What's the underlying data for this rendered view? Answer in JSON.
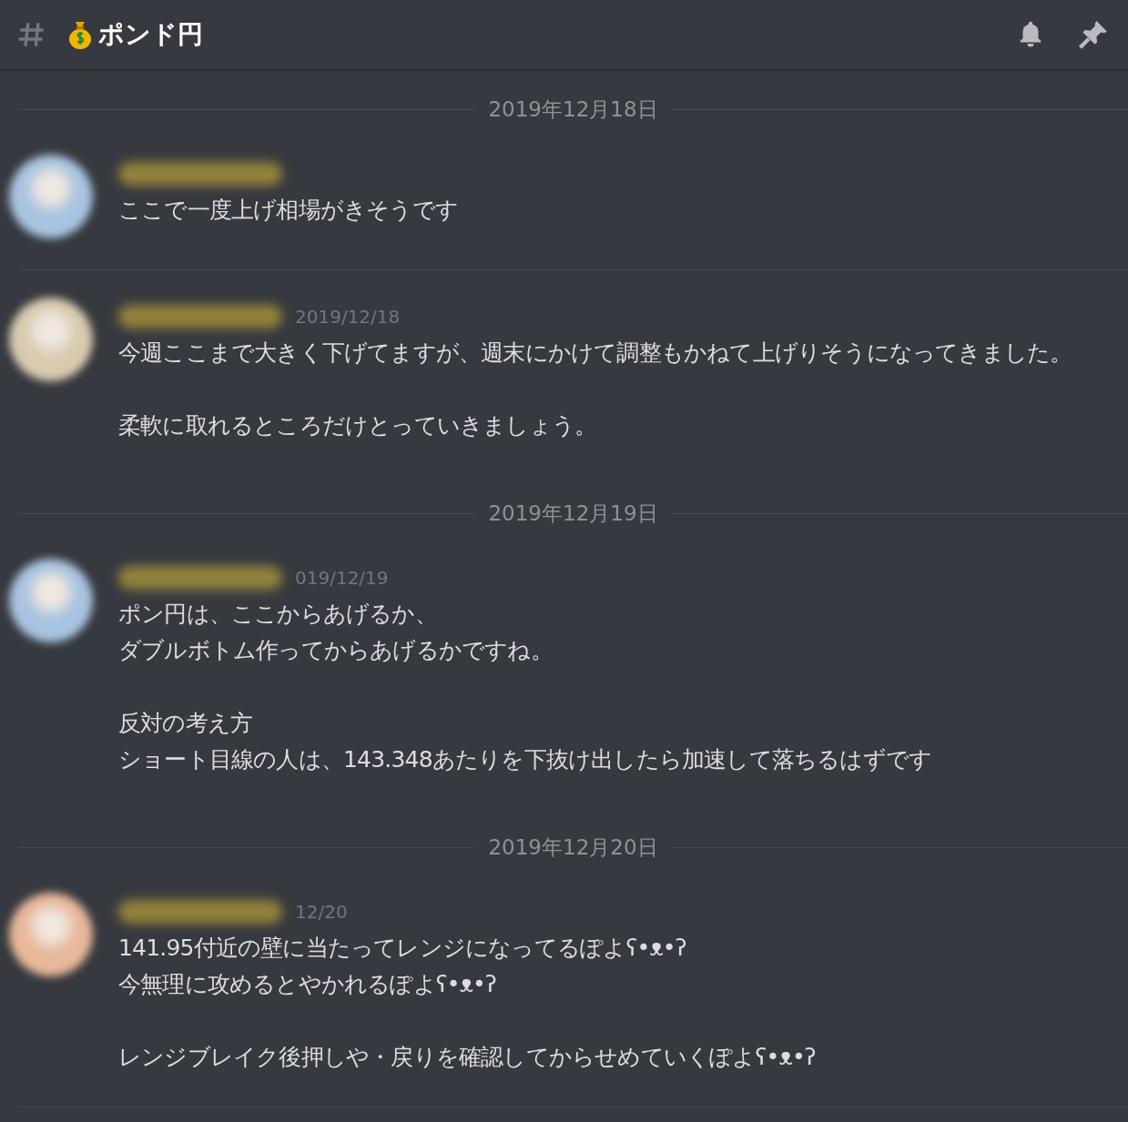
{
  "channel": {
    "title": "ポンド円"
  },
  "feed": [
    {
      "kind": "date",
      "label": "2019年12月18日"
    },
    {
      "kind": "message",
      "color": "#a9c4e0",
      "paragraphs": [
        [
          "ここで一度上げ相場がきそうです"
        ]
      ]
    },
    {
      "kind": "divider"
    },
    {
      "kind": "message",
      "color": "#d8cbb0",
      "timestamp": "2019/12/18",
      "paragraphs": [
        [
          "今週ここまで大きく下げてますが、週末にかけて調整もかねて上げりそうになってきました。"
        ],
        [
          "柔軟に取れるところだけとっていきましょう。"
        ]
      ]
    },
    {
      "kind": "date",
      "label": "2019年12月19日"
    },
    {
      "kind": "message",
      "color": "#a9c4e0",
      "timestamp": "019/12/19",
      "paragraphs": [
        [
          "ポン円は、ここからあげるか、",
          "ダブルボトム作ってからあげるかですね。"
        ],
        [
          "反対の考え方",
          "ショート目線の人は、143.348あたりを下抜け出したら加速して落ちるはずです"
        ]
      ]
    },
    {
      "kind": "date",
      "label": "2019年12月20日"
    },
    {
      "kind": "message",
      "color": "#e8b89a",
      "timestamp": "12/20",
      "paragraphs": [
        [
          "141.95付近の壁に当たってレンジになってるぽよʕ•ᴥ•ʔ",
          "今無理に攻めるとやかれるぽよʕ•ᴥ•ʔ"
        ],
        [
          "レンジブレイク後押しや・戻りを確認してからせめていくぽよʕ•ᴥ•ʔ"
        ]
      ]
    },
    {
      "kind": "divider"
    }
  ]
}
